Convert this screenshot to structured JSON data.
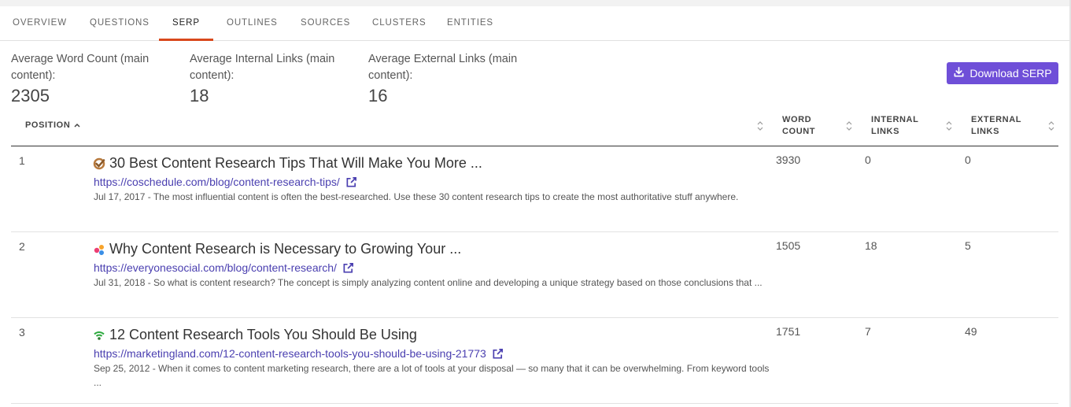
{
  "tabs": [
    {
      "label": "OVERVIEW"
    },
    {
      "label": "QUESTIONS"
    },
    {
      "label": "SERP"
    },
    {
      "label": "OUTLINES"
    },
    {
      "label": "SOURCES"
    },
    {
      "label": "CLUSTERS"
    },
    {
      "label": "ENTITIES"
    }
  ],
  "active_tab": "SERP",
  "stats": [
    {
      "label": "Average Word Count (main content):",
      "value": "2305"
    },
    {
      "label": "Average Internal Links (main content):",
      "value": "18"
    },
    {
      "label": "Average External Links (main content):",
      "value": "16"
    }
  ],
  "download_button": {
    "label": "Download SERP",
    "icon": "download-icon",
    "color": "#6f4fd8"
  },
  "table": {
    "headers": {
      "position": "POSITION",
      "word_count": "WORD COUNT",
      "internal_links": "INTERNAL LINKS",
      "external_links": "EXTERNAL LINKS"
    },
    "rows": [
      {
        "position": "1",
        "favicon": "coschedule-check-icon",
        "title": "30 Best Content Research Tips That Will Make You More ...",
        "url": "https://coschedule.com/blog/content-research-tips/",
        "description": "Jul 17, 2017 - The most influential content is often the best-researched. Use these 30 content research tips to create the most authoritative stuff anywhere.",
        "word_count": "3930",
        "internal_links": "0",
        "external_links": "0"
      },
      {
        "position": "2",
        "favicon": "everyonesocial-dots-icon",
        "title": "Why Content Research is Necessary to Growing Your ...",
        "url": "https://everyonesocial.com/blog/content-research/",
        "description": "Jul 31, 2018 - So what is content research? The concept is simply analyzing content online and developing a unique strategy based on those conclusions that ...",
        "word_count": "1505",
        "internal_links": "18",
        "external_links": "5"
      },
      {
        "position": "3",
        "favicon": "marketingland-signal-icon",
        "title": "12 Content Research Tools You Should Be Using",
        "url": "https://marketingland.com/12-content-research-tools-you-should-be-using-21773",
        "description": "Sep 25, 2012 - When it comes to content marketing research, there are a lot of tools at your disposal — so many that it can be overwhelming. From keyword tools ...",
        "word_count": "1751",
        "internal_links": "7",
        "external_links": "49"
      }
    ]
  },
  "colors": {
    "accent": "#d9481c",
    "link": "#4a3fb0",
    "button": "#6f4fd8"
  }
}
